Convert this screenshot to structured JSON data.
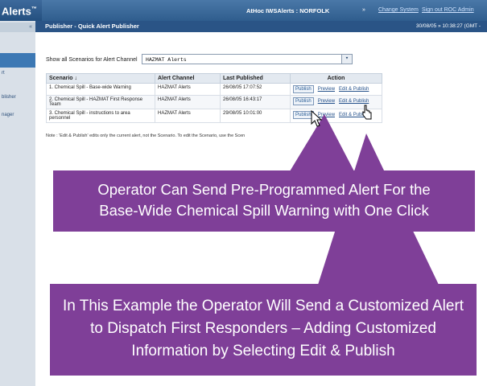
{
  "app": {
    "brand": "Alerts",
    "brand_mark": "™"
  },
  "sidebar": {
    "collapse_label": "«",
    "items": [
      {
        "label": "rt"
      },
      {
        "label": "blisher"
      },
      {
        "label": "nager"
      }
    ]
  },
  "header": {
    "system_info": "AtHoc IWSAlerts : NORFOLK",
    "separator": "»",
    "change_system": "Change System",
    "sign_out": "Sign out ROC Admin"
  },
  "subheader": {
    "title": "Publisher - Quick Alert Publisher",
    "datetime": "30/08/05 » 10:38:27 (GMT -"
  },
  "filter": {
    "label": "Show all Scenarios for Alert Channel",
    "selected": "HAZMAT Alerts"
  },
  "table": {
    "columns": [
      "Scenario ↓",
      "Alert Channel",
      "Last Published",
      "Action"
    ],
    "rows": [
      {
        "scenario": "1. Chemical Spill - Base-wide Warning",
        "channel": "HAZMAT Alerts",
        "published": "26/08/05 17:07:52"
      },
      {
        "scenario": "2. Chemical Spill - HAZMAT First Response Team",
        "channel": "HAZMAT Alerts",
        "published": "26/08/05 16:43:17"
      },
      {
        "scenario": "3. Chemical Spill - instructions to area personnel",
        "channel": "HAZMAT Alerts",
        "published": "29/08/05 10:01:00"
      }
    ],
    "actions": {
      "publish": "Publish",
      "preview": "Preview",
      "edit_publish": "Edit & Publish"
    }
  },
  "note": "Note : 'Edit & Publish' edits only the current alert, not the Scenario. To edit the Scenario, use the Scen",
  "callouts": {
    "one": [
      "Operator Can Send Pre-Programmed Alert For the",
      "Base-Wide Chemical Spill Warning with One Click"
    ],
    "two": [
      "In This Example the Operator Will Send a Customized Alert",
      "to Dispatch First Responders – Adding Customized",
      "Information by Selecting Edit & Publish"
    ]
  },
  "colors": {
    "callout": "#7f3f98",
    "header": "#2f5d8e",
    "subheader": "#2a5486"
  }
}
